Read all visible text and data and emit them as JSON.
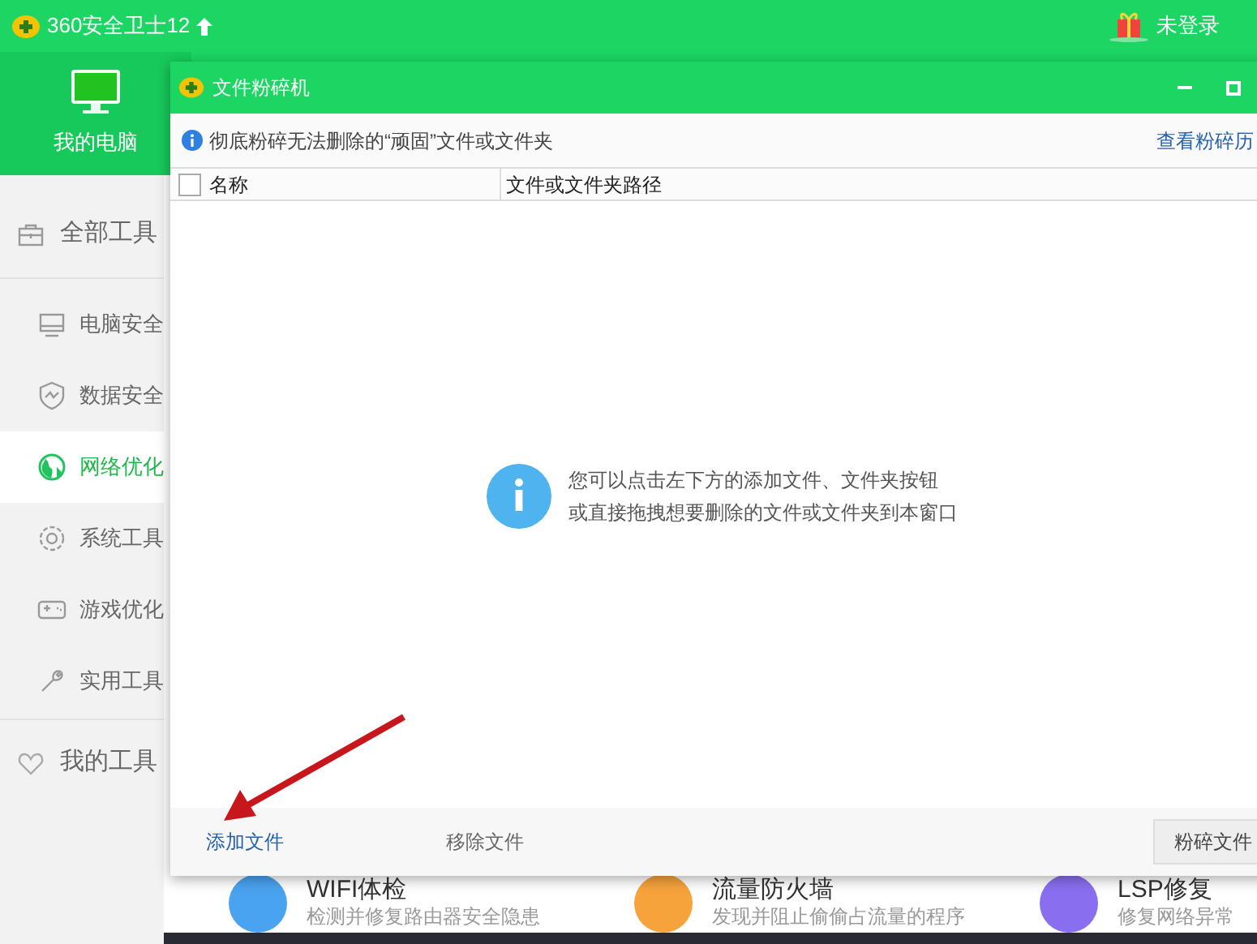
{
  "app": {
    "title": "360安全卫士12",
    "user": "未登录",
    "nav": [
      {
        "label": "我的电脑",
        "selected": true
      }
    ]
  },
  "sidebar": {
    "items": [
      {
        "kind": "group",
        "label": "全部工具",
        "selected": false
      },
      {
        "kind": "item",
        "label": "电脑安全",
        "selected": false
      },
      {
        "kind": "item",
        "label": "数据安全",
        "selected": false
      },
      {
        "kind": "item",
        "label": "网络优化",
        "selected": true
      },
      {
        "kind": "item",
        "label": "系统工具",
        "selected": false
      },
      {
        "kind": "item",
        "label": "游戏优化",
        "selected": false
      },
      {
        "kind": "item",
        "label": "实用工具",
        "selected": false
      },
      {
        "kind": "group",
        "label": "我的工具",
        "selected": false
      }
    ]
  },
  "tools": [
    {
      "title": "WIFI体检",
      "description": "检测并修复路由器安全隐患",
      "color": "#4aa3f0"
    },
    {
      "title": "流量防火墙",
      "description": "发现并阻止偷偷占流量的程序",
      "color": "#f6a33c"
    },
    {
      "title": "LSP修复",
      "description": "修复网络异常",
      "color": "#8a6ef0"
    }
  ],
  "dialog": {
    "title": "文件粉碎机",
    "notice": "彻底粉碎无法删除的“顽固”文件或文件夹",
    "history_link": "查看粉碎历",
    "select_all": {
      "checked": false
    },
    "columns": [
      "名称",
      "文件或文件夹路径"
    ],
    "empty_message": [
      "您可以点击左下方的添加文件、文件夹按钮",
      "或直接拖拽想要删除的文件或文件夹到本窗口"
    ],
    "buttons": [
      {
        "label": "添加文件",
        "kind": "link"
      },
      {
        "label": "移除文件",
        "kind": "plain"
      },
      {
        "label": "粉碎文件",
        "kind": "primary"
      }
    ]
  }
}
